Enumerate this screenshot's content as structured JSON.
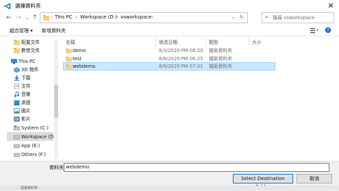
{
  "window": {
    "title": "選擇資料夾",
    "close_glyph": "✕",
    "app_icon": "vscode-icon"
  },
  "nav": {
    "back_glyph": "←",
    "forward_glyph": "→",
    "dropdown_glyph": "⌄",
    "up_glyph": "↑",
    "refresh_glyph": "↻",
    "breadcrumb": [
      "This PC",
      "Workspace (D:)",
      "vsworkspace"
    ],
    "breadcrumb_sep": "›",
    "search_placeholder": "搜尋 vsworkspace",
    "search_icon_glyph": "⌕"
  },
  "toolbar": {
    "organize_label": "組合管理 ▾",
    "new_folder_label": "新增資料夾"
  },
  "sidebar": {
    "items": [
      {
        "label": "配置文件",
        "icon": "folder-icon"
      },
      {
        "label": "數學文件",
        "icon": "folder-icon"
      },
      {
        "label": "This PC",
        "icon": "computer-icon"
      },
      {
        "label": "3D 物件",
        "icon": "3d-objects-icon"
      },
      {
        "label": "下載",
        "icon": "download-icon"
      },
      {
        "label": "文件",
        "icon": "document-icon"
      },
      {
        "label": "音樂",
        "icon": "music-icon"
      },
      {
        "label": "桌面",
        "icon": "desktop-icon"
      },
      {
        "label": "圖片",
        "icon": "pictures-icon"
      },
      {
        "label": "影片",
        "icon": "video-icon"
      },
      {
        "label": "System (C:)",
        "icon": "drive-icon"
      },
      {
        "label": "Workspace (D:)",
        "icon": "drive-icon"
      },
      {
        "label": "App (E:)",
        "icon": "drive-icon"
      },
      {
        "label": "Others (F:)",
        "icon": "drive-icon"
      }
    ]
  },
  "columns": {
    "name": "名稱",
    "modified": "修改日期",
    "type": "類型",
    "size": "大小"
  },
  "files": [
    {
      "name": "demo",
      "modified": "8/3/2020 PM 08:20",
      "type": "檔案資料夾",
      "size": ""
    },
    {
      "name": "test",
      "modified": "8/8/2020 PM 06:25",
      "type": "檔案資料夾",
      "size": ""
    },
    {
      "name": "webdemo",
      "modified": "8/9/2020 PM 07:31",
      "type": "檔案資料夾",
      "size": ""
    }
  ],
  "footer": {
    "folder_label": "資料夾:",
    "folder_value": "webdemo",
    "select_button": "Select Destination Folder",
    "cancel_button": "取消",
    "strip_text": "認識資料夾"
  },
  "colors": {
    "selection": "#cce8ff",
    "accent": "#0078d7",
    "folder": "#f5d27a"
  }
}
